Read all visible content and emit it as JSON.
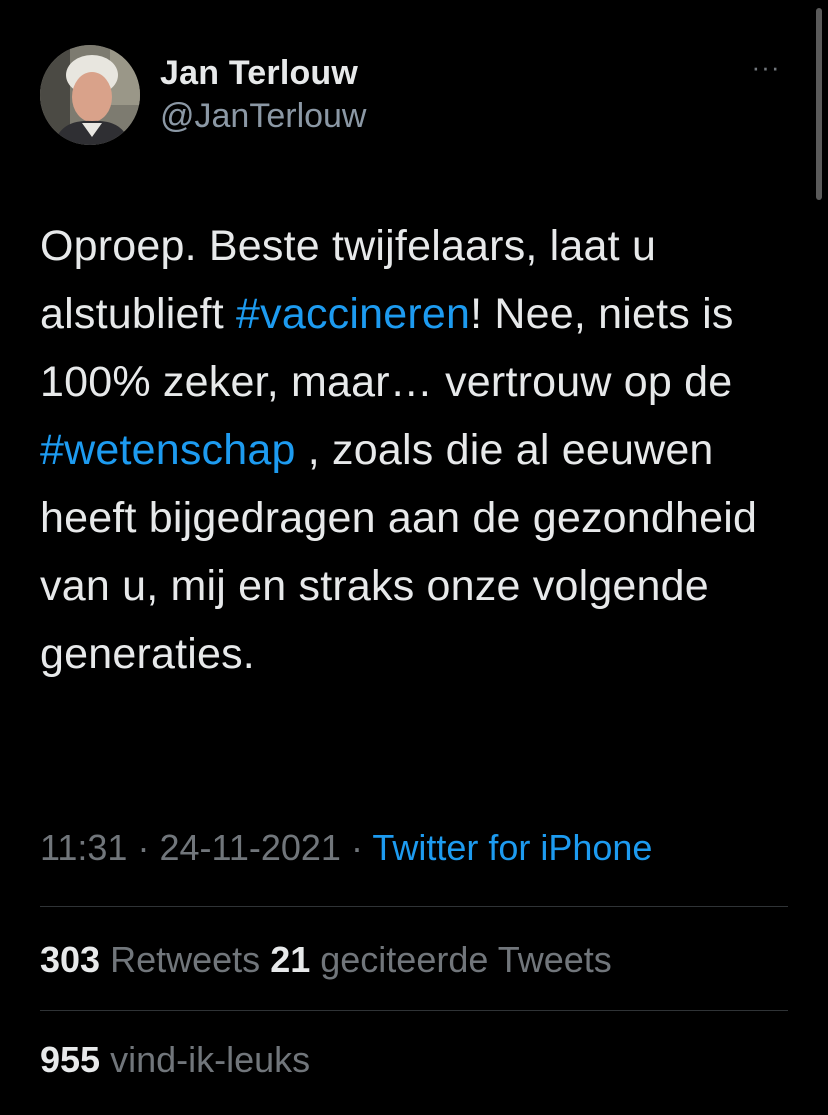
{
  "author": {
    "display_name": "Jan Terlouw",
    "handle": "@JanTerlouw"
  },
  "tweet": {
    "segments": [
      {
        "text": "Oproep. Beste twijfelaars, laat u alstublieft ",
        "type": "text"
      },
      {
        "text": "#vaccineren",
        "type": "hashtag"
      },
      {
        "text": "! Nee, niets  is 100% zeker, maar… vertrouw op de ",
        "type": "text"
      },
      {
        "text": "#wetenschap",
        "type": "hashtag"
      },
      {
        "text": " , zoals die al eeuwen heeft bijgedragen aan de gezondheid van u, mij en straks onze volgende generaties.",
        "type": "text"
      }
    ]
  },
  "meta": {
    "time": "11:31",
    "separator": "·",
    "date": "24-11-2021",
    "source": "Twitter for iPhone"
  },
  "stats": {
    "retweets_count": "303",
    "retweets_label": "Retweets",
    "quotes_count": "21",
    "quotes_label": "geciteerde Tweets",
    "likes_count": "955",
    "likes_label": "vind-ik-leuks"
  },
  "icons": {
    "more": "more-horizontal-icon"
  },
  "colors": {
    "background": "#000000",
    "text": "#e7e9ea",
    "secondary": "#71767b",
    "link": "#1d9bf0",
    "divider": "#2f3336"
  }
}
